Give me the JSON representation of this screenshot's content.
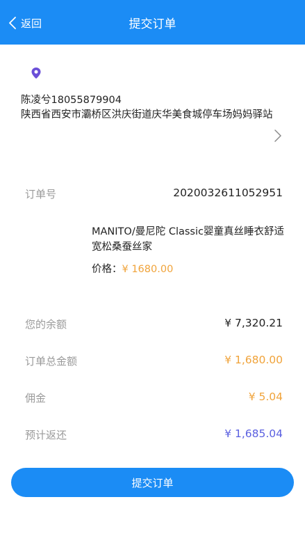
{
  "header": {
    "back_label": "返回",
    "title": "提交订单"
  },
  "address": {
    "icon": "location-pin-icon",
    "name_phone": "陈凌兮18055879904",
    "detail": "陕西省西安市灞桥区洪庆街道庆华美食城停车场妈妈驿站"
  },
  "order": {
    "number_label": "订单号",
    "number_value": "2020032611052951",
    "product_name": "MANITO/曼尼陀 Classic婴童真丝睡衣舒适宽松桑蚕丝家",
    "price_label": "价格：",
    "price_value": "¥ 1680.00"
  },
  "summary": {
    "balance_label": "您的余额",
    "balance_value": "¥ 7,320.21",
    "total_label": "订单总金额",
    "total_value": "¥ 1,680.00",
    "commission_label": "佣金",
    "commission_value": "¥ 5.04",
    "refund_label": "预计返还",
    "refund_value": "¥ 1,685.04"
  },
  "submit_label": "提交订单",
  "colors": {
    "primary": "#1b8cf5",
    "accent_orange": "#f0a33a",
    "accent_purple": "#5a5fe0",
    "pin": "#6b4fd8"
  }
}
